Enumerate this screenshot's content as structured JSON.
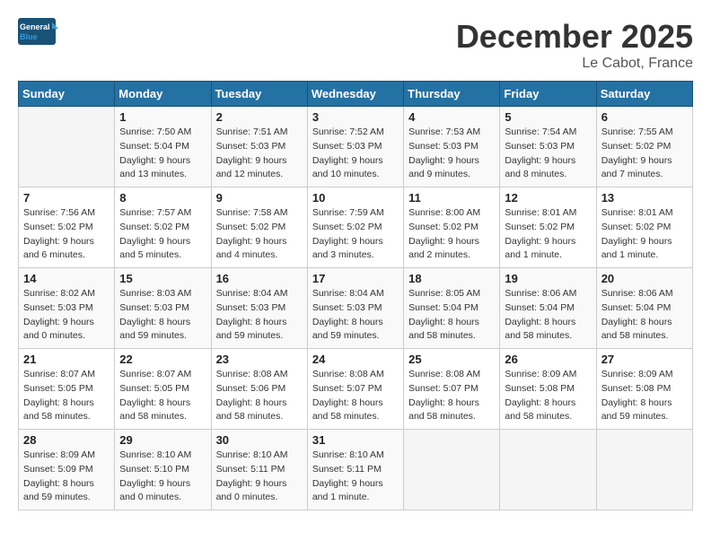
{
  "header": {
    "logo_text_general": "General",
    "logo_text_blue": "Blue",
    "month_title": "December 2025",
    "location": "Le Cabot, France"
  },
  "days_of_week": [
    "Sunday",
    "Monday",
    "Tuesday",
    "Wednesday",
    "Thursday",
    "Friday",
    "Saturday"
  ],
  "weeks": [
    [
      {
        "day": "",
        "empty": true
      },
      {
        "day": "1",
        "sunrise": "7:50 AM",
        "sunset": "5:04 PM",
        "daylight": "9 hours and 13 minutes."
      },
      {
        "day": "2",
        "sunrise": "7:51 AM",
        "sunset": "5:03 PM",
        "daylight": "9 hours and 12 minutes."
      },
      {
        "day": "3",
        "sunrise": "7:52 AM",
        "sunset": "5:03 PM",
        "daylight": "9 hours and 10 minutes."
      },
      {
        "day": "4",
        "sunrise": "7:53 AM",
        "sunset": "5:03 PM",
        "daylight": "9 hours and 9 minutes."
      },
      {
        "day": "5",
        "sunrise": "7:54 AM",
        "sunset": "5:03 PM",
        "daylight": "9 hours and 8 minutes."
      },
      {
        "day": "6",
        "sunrise": "7:55 AM",
        "sunset": "5:02 PM",
        "daylight": "9 hours and 7 minutes."
      }
    ],
    [
      {
        "day": "7",
        "sunrise": "7:56 AM",
        "sunset": "5:02 PM",
        "daylight": "9 hours and 6 minutes."
      },
      {
        "day": "8",
        "sunrise": "7:57 AM",
        "sunset": "5:02 PM",
        "daylight": "9 hours and 5 minutes."
      },
      {
        "day": "9",
        "sunrise": "7:58 AM",
        "sunset": "5:02 PM",
        "daylight": "9 hours and 4 minutes."
      },
      {
        "day": "10",
        "sunrise": "7:59 AM",
        "sunset": "5:02 PM",
        "daylight": "9 hours and 3 minutes."
      },
      {
        "day": "11",
        "sunrise": "8:00 AM",
        "sunset": "5:02 PM",
        "daylight": "9 hours and 2 minutes."
      },
      {
        "day": "12",
        "sunrise": "8:01 AM",
        "sunset": "5:02 PM",
        "daylight": "9 hours and 1 minute."
      },
      {
        "day": "13",
        "sunrise": "8:01 AM",
        "sunset": "5:02 PM",
        "daylight": "9 hours and 1 minute."
      }
    ],
    [
      {
        "day": "14",
        "sunrise": "8:02 AM",
        "sunset": "5:03 PM",
        "daylight": "9 hours and 0 minutes."
      },
      {
        "day": "15",
        "sunrise": "8:03 AM",
        "sunset": "5:03 PM",
        "daylight": "8 hours and 59 minutes."
      },
      {
        "day": "16",
        "sunrise": "8:04 AM",
        "sunset": "5:03 PM",
        "daylight": "8 hours and 59 minutes."
      },
      {
        "day": "17",
        "sunrise": "8:04 AM",
        "sunset": "5:03 PM",
        "daylight": "8 hours and 59 minutes."
      },
      {
        "day": "18",
        "sunrise": "8:05 AM",
        "sunset": "5:04 PM",
        "daylight": "8 hours and 58 minutes."
      },
      {
        "day": "19",
        "sunrise": "8:06 AM",
        "sunset": "5:04 PM",
        "daylight": "8 hours and 58 minutes."
      },
      {
        "day": "20",
        "sunrise": "8:06 AM",
        "sunset": "5:04 PM",
        "daylight": "8 hours and 58 minutes."
      }
    ],
    [
      {
        "day": "21",
        "sunrise": "8:07 AM",
        "sunset": "5:05 PM",
        "daylight": "8 hours and 58 minutes."
      },
      {
        "day": "22",
        "sunrise": "8:07 AM",
        "sunset": "5:05 PM",
        "daylight": "8 hours and 58 minutes."
      },
      {
        "day": "23",
        "sunrise": "8:08 AM",
        "sunset": "5:06 PM",
        "daylight": "8 hours and 58 minutes."
      },
      {
        "day": "24",
        "sunrise": "8:08 AM",
        "sunset": "5:07 PM",
        "daylight": "8 hours and 58 minutes."
      },
      {
        "day": "25",
        "sunrise": "8:08 AM",
        "sunset": "5:07 PM",
        "daylight": "8 hours and 58 minutes."
      },
      {
        "day": "26",
        "sunrise": "8:09 AM",
        "sunset": "5:08 PM",
        "daylight": "8 hours and 58 minutes."
      },
      {
        "day": "27",
        "sunrise": "8:09 AM",
        "sunset": "5:08 PM",
        "daylight": "8 hours and 59 minutes."
      }
    ],
    [
      {
        "day": "28",
        "sunrise": "8:09 AM",
        "sunset": "5:09 PM",
        "daylight": "8 hours and 59 minutes."
      },
      {
        "day": "29",
        "sunrise": "8:10 AM",
        "sunset": "5:10 PM",
        "daylight": "9 hours and 0 minutes."
      },
      {
        "day": "30",
        "sunrise": "8:10 AM",
        "sunset": "5:11 PM",
        "daylight": "9 hours and 0 minutes."
      },
      {
        "day": "31",
        "sunrise": "8:10 AM",
        "sunset": "5:11 PM",
        "daylight": "9 hours and 1 minute."
      },
      {
        "day": "",
        "empty": true
      },
      {
        "day": "",
        "empty": true
      },
      {
        "day": "",
        "empty": true
      }
    ]
  ]
}
